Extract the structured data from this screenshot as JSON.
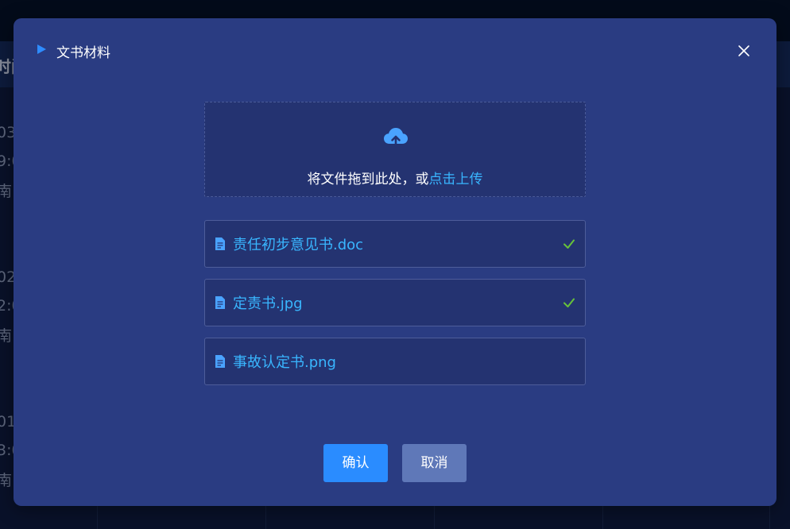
{
  "background": {
    "header_fragment": "时间",
    "rows": [
      {
        "line1": "03",
        "line2": "9:0",
        "line3": "南"
      },
      {
        "line1": "02",
        "line2": "2:0",
        "line3": "南"
      },
      {
        "line1": "01",
        "line2": "3:0",
        "line3": "南"
      }
    ]
  },
  "dialog": {
    "title": "文书材料",
    "upload": {
      "hint": "将文件拖到此处，或",
      "link": "点击上传"
    },
    "files": [
      {
        "name": "责任初步意见书.doc",
        "status": "success"
      },
      {
        "name": "定责书.jpg",
        "status": "success"
      },
      {
        "name": "事故认定书.png",
        "status": "none"
      }
    ],
    "confirm_label": "确认",
    "cancel_label": "取消"
  },
  "colors": {
    "dialog_bg": "#2a3c82",
    "accent": "#2a8cff",
    "link": "#39b6ff",
    "success": "#67c23a"
  }
}
